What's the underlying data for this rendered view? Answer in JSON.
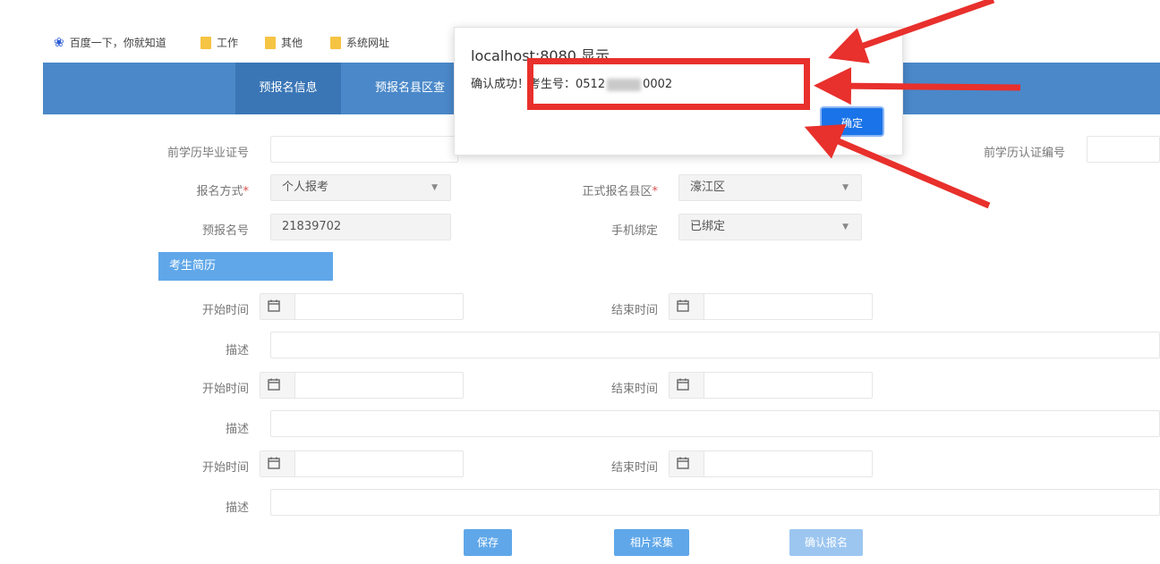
{
  "bookmarks": [
    {
      "icon": "paw-icon",
      "label": "百度一下，你就知道"
    },
    {
      "icon": "folder-icon",
      "label": "工作"
    },
    {
      "icon": "folder-icon",
      "label": "其他"
    },
    {
      "icon": "folder-icon",
      "label": "系统网址"
    }
  ],
  "nav": {
    "tabs": [
      "预报名信息",
      "预报名县区查"
    ]
  },
  "form": {
    "grad_cert_label": "前学历毕业证号",
    "grad_cert_value": "",
    "cert_no_label": "前学历认证编号",
    "cert_no_value": "",
    "reg_method_label": "报名方式",
    "reg_method_value": "个人报考",
    "district_label": "正式报名县区",
    "district_value": "濠江区",
    "prereg_no_label": "预报名号",
    "prereg_no_value": "21839702",
    "phone_bind_label": "手机绑定",
    "phone_bind_value": "已绑定",
    "section_title": "考生简历",
    "resume": [
      {
        "start_label": "开始时间",
        "end_label": "结束时间",
        "desc_label": "描述"
      },
      {
        "start_label": "开始时间",
        "end_label": "结束时间",
        "desc_label": "描述"
      },
      {
        "start_label": "开始时间",
        "end_label": "结束时间",
        "desc_label": "描述"
      }
    ]
  },
  "buttons": {
    "save": "保存",
    "photo": "相片采集",
    "confirm_reg": "确认报名"
  },
  "dialog": {
    "title": "localhost:8080 显示",
    "message_prefix": "确认成功！考生号：0512",
    "message_suffix": "0002",
    "ok": "确定"
  },
  "colors": {
    "nav": "#4a88c9",
    "section": "#5fa7e9",
    "button": "#5fa7e9",
    "annotation": "#e8302c",
    "dialog_ok": "#1a73e8"
  }
}
